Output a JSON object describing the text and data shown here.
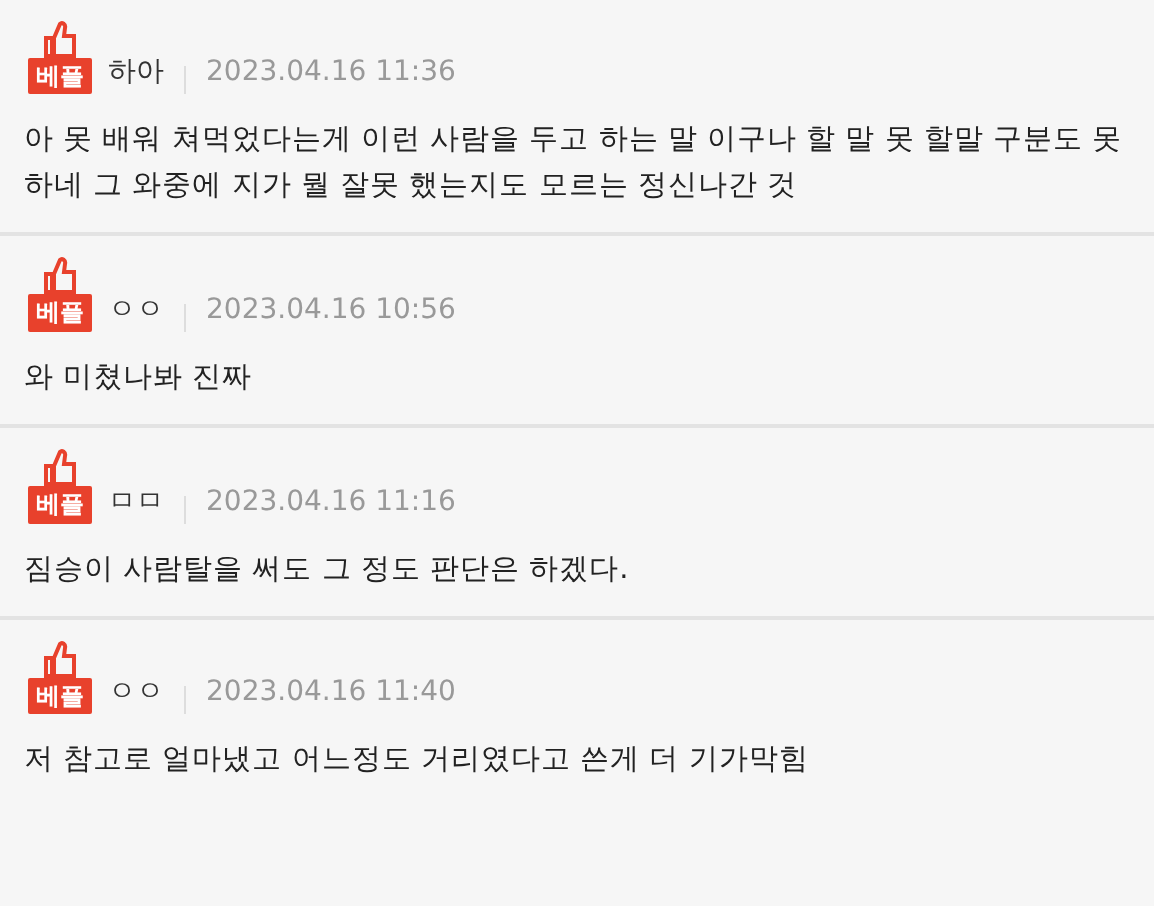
{
  "comments": [
    {
      "badge": "베플",
      "author": "하아",
      "date": "2023.04.16 11:36",
      "text": "아 못 배워 쳐먹었다는게 이런 사람을 두고 하는 말 이구나 할 말 못 할말 구분도 못하네 그 와중에 지가 뭘 잘못 했는지도 모르는 정신나간 것"
    },
    {
      "badge": "베플",
      "author": "ㅇㅇ",
      "date": "2023.04.16 10:56",
      "text": "와 미쳤나봐 진짜"
    },
    {
      "badge": "베플",
      "author": "ㅁㅁ",
      "date": "2023.04.16 11:16",
      "text": "짐승이 사람탈을 써도 그 정도 판단은 하겠다."
    },
    {
      "badge": "베플",
      "author": "ㅇㅇ",
      "date": "2023.04.16 11:40",
      "text": "저 참고로 얼마냈고 어느정도 거리였다고 쓴게 더 기가막힘"
    }
  ]
}
